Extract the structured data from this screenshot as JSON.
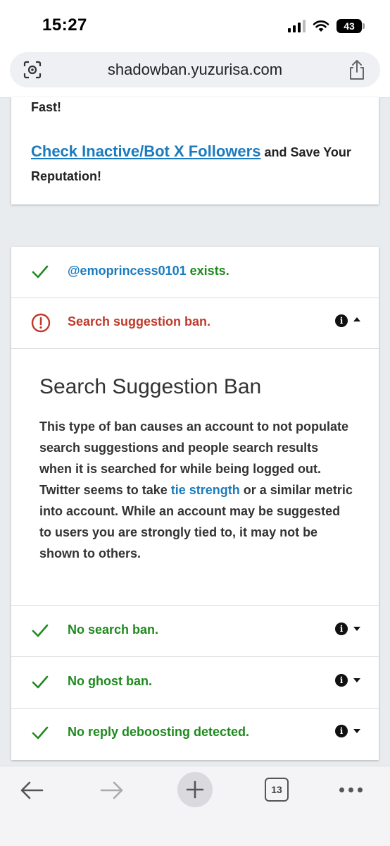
{
  "status_bar": {
    "time": "15:27",
    "battery": "43"
  },
  "address_bar": {
    "url": "shadowban.yuzurisa.com"
  },
  "promo": {
    "fast_text": "Fast!",
    "link_text": "Check Inactive/Bot X Followers",
    "tail_text": " and Save Your Reputation!"
  },
  "results": {
    "exists": {
      "username": "@emoprincess0101",
      "suffix": " exists."
    },
    "suggestion_ban": {
      "label": "Search suggestion ban.",
      "status": "fail"
    },
    "detail": {
      "title": "Search Suggestion Ban",
      "body_before": "This type of ban causes an account to not populate search suggestions and people search results when it is searched for while being logged out. Twitter seems to take ",
      "body_link": "tie strength",
      "body_after": " or a similar metric into account. While an account may be suggested to users you are strongly tied to, it may not be shown to others."
    },
    "search_ban": {
      "label": "No search ban.",
      "status": "pass"
    },
    "ghost_ban": {
      "label": "No ghost ban.",
      "status": "pass"
    },
    "reply_deboost": {
      "label": "No reply deboosting detected.",
      "status": "pass"
    }
  },
  "toolbar": {
    "tab_count": "13"
  },
  "colors": {
    "pass": "#1e8a1e",
    "fail": "#c0392b",
    "link": "#1a7bbf"
  }
}
